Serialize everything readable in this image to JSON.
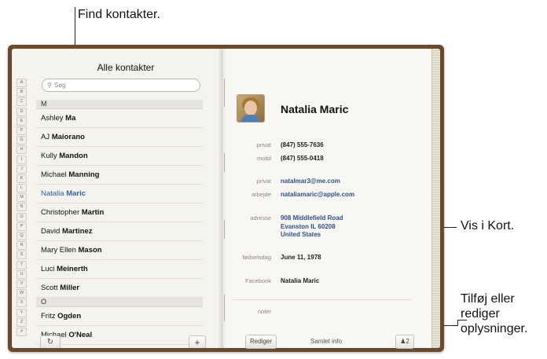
{
  "callouts": {
    "find": "Find kontakter.",
    "map": "Vis i Kort.",
    "edit_lines": [
      "Tilføj eller",
      "rediger",
      "oplysninger."
    ]
  },
  "left_page": {
    "title": "Alle kontakter",
    "search_placeholder": "Søg",
    "index_letters": [
      "A",
      "B",
      "C",
      "D",
      "E",
      "F",
      "G",
      "H",
      "I",
      "J",
      "K",
      "L",
      "M",
      "N",
      "O",
      "P",
      "Q",
      "R",
      "S",
      "T",
      "U",
      "V",
      "W",
      "X",
      "Y",
      "Z",
      "#"
    ],
    "sections": [
      {
        "letter": "M",
        "contacts": [
          {
            "first": "Ashley",
            "last": "Ma",
            "selected": false
          },
          {
            "first": "AJ",
            "last": "Maiorano",
            "selected": false
          },
          {
            "first": "Kully",
            "last": "Mandon",
            "selected": false
          },
          {
            "first": "Michael",
            "last": "Manning",
            "selected": false
          },
          {
            "first": "Natalia",
            "last": "Maric",
            "selected": true
          },
          {
            "first": "Christopher",
            "last": "Martin",
            "selected": false
          },
          {
            "first": "David",
            "last": "Martinez",
            "selected": false
          },
          {
            "first": "Mary Ellen",
            "last": "Mason",
            "selected": false
          },
          {
            "first": "Luci",
            "last": "Meinerth",
            "selected": false
          },
          {
            "first": "Scott",
            "last": "Miller",
            "selected": false
          }
        ]
      },
      {
        "letter": "O",
        "contacts": [
          {
            "first": "Fritz",
            "last": "Ogden",
            "selected": false
          },
          {
            "first": "Michael",
            "last": "O'Neal",
            "selected": false
          }
        ]
      }
    ],
    "refresh_icon": "refresh-icon",
    "add_label": "+"
  },
  "contact": {
    "name": "Natalia Maric",
    "fields": {
      "phone_home": {
        "label": "privat",
        "value": "(847) 555-7636"
      },
      "phone_mobile": {
        "label": "mobil",
        "value": "(847) 555-0418"
      },
      "email_home": {
        "label": "privat",
        "value": "natalmar3@me.com"
      },
      "email_work": {
        "label": "arbejde",
        "value": "nataliamaric@apple.com"
      },
      "address": {
        "label": "adresse",
        "lines": [
          "908 Middlefield Road",
          "Evanston IL 60208",
          "United States"
        ]
      },
      "birthday": {
        "label": "fødselsdag",
        "value": "June 11, 1978"
      },
      "facebook": {
        "label": "Facebook",
        "value": "Natalia Maric"
      },
      "notes": {
        "label": "noter"
      }
    },
    "toolbar": {
      "edit": "Rediger",
      "info": "Samlet info",
      "linked_count": "2"
    }
  },
  "colors": {
    "selected": "#2f5fa8",
    "book_cover": "#6b4a2b"
  }
}
